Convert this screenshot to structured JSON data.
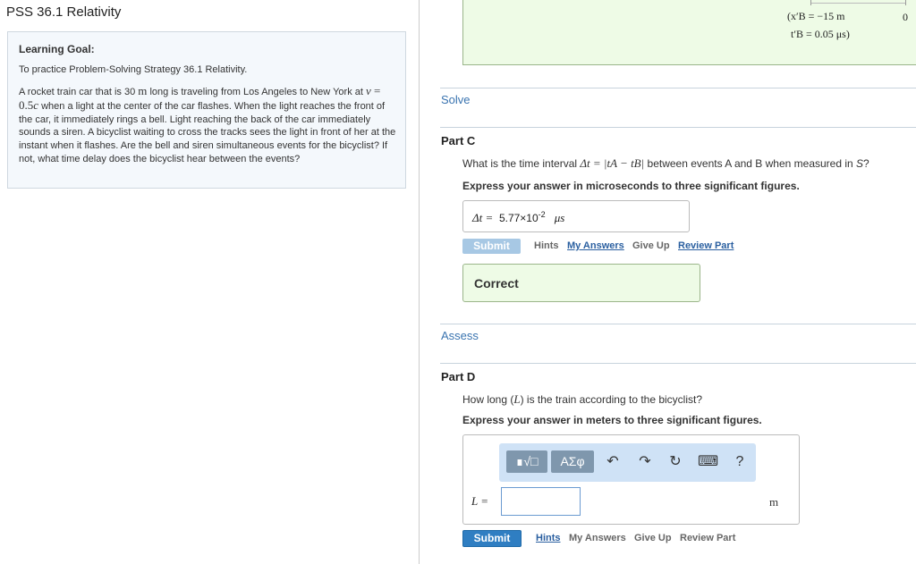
{
  "page": {
    "title": "PSS 36.1 Relativity"
  },
  "learning_goal": {
    "heading": "Learning Goal:",
    "intro": "To practice Problem-Solving Strategy 36.1 Relativity.",
    "text_parts": [
      "A rocket train car that is 30 ",
      "m",
      " long is traveling from Los Angeles to  New York at ",
      "v",
      " = 0.5",
      "c",
      "  when a light at the center of the car flashes.  When the light reaches the front of the car, it immediately rings a  bell. Light reaching the back of the car immediately sounds a  siren. A bicyclist waiting to cross the tracks sees the light in front of her at the instant when it flashes. Are the bell and siren simultaneous events for the bicyclist? If not, what time delay does the bicyclist hear between the events?"
    ]
  },
  "top_panel": {
    "event_x": "(x′B = −15 m",
    "event_t": "t′B = 0.05 μs)",
    "zero_label": "0"
  },
  "sections": {
    "solve": "Solve",
    "assess": "Assess"
  },
  "part_c": {
    "title": "Part C",
    "question_pre": "What is the time interval ",
    "question_math": "Δt = |tA − tB|",
    "question_post": " between events A and B when measured in ",
    "question_frame": "S",
    "question_end": "?",
    "instruction": "Express your answer in microseconds to three significant figures.",
    "answer_label": "Δt =",
    "answer_value": "5.77×10",
    "answer_exp": "-2",
    "answer_unit": "μs",
    "submit": "Submit",
    "hints": "Hints",
    "my_answers": "My Answers",
    "give_up": "Give Up",
    "review_part": "Review Part",
    "feedback": "Correct"
  },
  "part_d": {
    "title": "Part D",
    "question_pre": "How long (",
    "question_var": "L",
    "question_post": ") is the train according to the bicyclist?",
    "instruction": "Express your answer in meters to three significant figures.",
    "toolbar": {
      "templates": "∎√□",
      "greek": "ΑΣφ",
      "undo": "↶",
      "redo": "↷",
      "reset": "↻",
      "keyboard": "⌨",
      "help": "?"
    },
    "answer_label": "L =",
    "answer_value": "",
    "unit": "m",
    "submit": "Submit",
    "hints": "Hints",
    "my_answers": "My Answers",
    "give_up": "Give Up",
    "review_part": "Review Part"
  },
  "colors": {
    "link": "#2a5fa0",
    "submit": "#2f7ec2",
    "correct_bg": "#eefbe6"
  }
}
